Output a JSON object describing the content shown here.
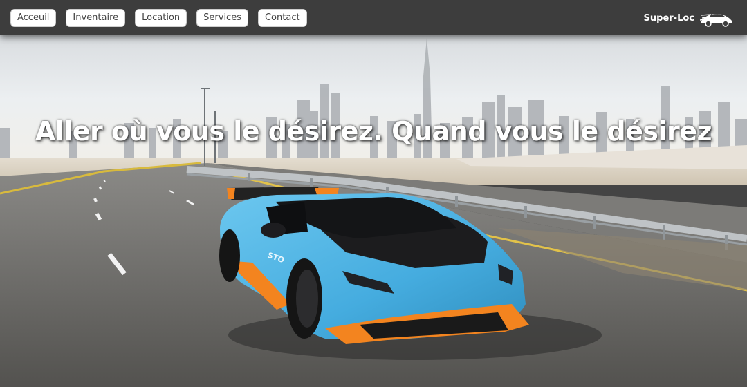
{
  "nav": {
    "items": [
      {
        "label": "Acceuil"
      },
      {
        "label": "Inventaire"
      },
      {
        "label": "Location"
      },
      {
        "label": "Services"
      },
      {
        "label": "Contact"
      }
    ]
  },
  "brand": {
    "name": "Super-Loc",
    "logo_icon": "sports-car-logo-icon"
  },
  "hero": {
    "headline": "Aller où vous le désirez. Quand vous le désirez",
    "image_icon": "blue-lamborghini-city-road-photo"
  },
  "colors": {
    "navbar": "#3d3d3d",
    "button_bg": "#ffffff",
    "button_text": "#444444",
    "car_body": "#47b2e6",
    "car_accent": "#f3841f"
  }
}
